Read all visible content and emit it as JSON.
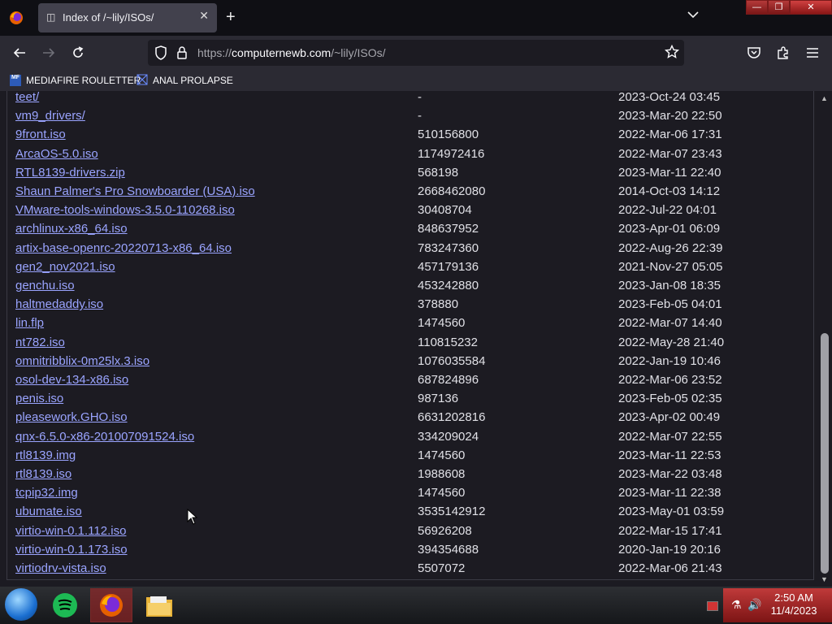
{
  "browser": {
    "tab_title": "Index of /~lily/ISOs/",
    "url_prefix": "https://",
    "url_domain": "computernewb.com",
    "url_path": "/~lily/ISOs/"
  },
  "bookmarks": [
    {
      "label": "MEDIAFIRE ROULETTER",
      "icon_text": "MF"
    },
    {
      "label": "ANAL PROLAPSE"
    }
  ],
  "files": [
    {
      "name": "teet/",
      "size": "-",
      "date": "2023-Oct-24 03:45"
    },
    {
      "name": "vm9_drivers/",
      "size": "-",
      "date": "2023-Mar-20 22:50"
    },
    {
      "name": "9front.iso",
      "size": "510156800",
      "date": "2022-Mar-06 17:31"
    },
    {
      "name": "ArcaOS-5.0.iso",
      "size": "1174972416",
      "date": "2022-Mar-07 23:43"
    },
    {
      "name": "RTL8139-drivers.zip",
      "size": "568198",
      "date": "2023-Mar-11 22:40"
    },
    {
      "name": "Shaun Palmer's Pro Snowboarder (USA).iso",
      "size": "2668462080",
      "date": "2014-Oct-03 14:12"
    },
    {
      "name": "VMware-tools-windows-3.5.0-110268.iso",
      "size": "30408704",
      "date": "2022-Jul-22 04:01"
    },
    {
      "name": "archlinux-x86_64.iso",
      "size": "848637952",
      "date": "2023-Apr-01 06:09"
    },
    {
      "name": "artix-base-openrc-20220713-x86_64.iso",
      "size": "783247360",
      "date": "2022-Aug-26 22:39"
    },
    {
      "name": "gen2_nov2021.iso",
      "size": "457179136",
      "date": "2021-Nov-27 05:05"
    },
    {
      "name": "genchu.iso",
      "size": "453242880",
      "date": "2023-Jan-08 18:35"
    },
    {
      "name": "haltmedaddy.iso",
      "size": "378880",
      "date": "2023-Feb-05 04:01"
    },
    {
      "name": "lin.flp",
      "size": "1474560",
      "date": "2022-Mar-07 14:40"
    },
    {
      "name": "nt782.iso",
      "size": "110815232",
      "date": "2022-May-28 21:40"
    },
    {
      "name": "omnitribblix-0m25lx.3.iso",
      "size": "1076035584",
      "date": "2022-Jan-19 10:46"
    },
    {
      "name": "osol-dev-134-x86.iso",
      "size": "687824896",
      "date": "2022-Mar-06 23:52"
    },
    {
      "name": "penis.iso",
      "size": "987136",
      "date": "2023-Feb-05 02:35"
    },
    {
      "name": "pleasework.GHO.iso",
      "size": "6631202816",
      "date": "2023-Apr-02 00:49"
    },
    {
      "name": "qnx-6.5.0-x86-201007091524.iso",
      "size": "334209024",
      "date": "2022-Mar-07 22:55"
    },
    {
      "name": "rtl8139.img",
      "size": "1474560",
      "date": "2023-Mar-11 22:53"
    },
    {
      "name": "rtl8139.iso",
      "size": "1988608",
      "date": "2023-Mar-22 03:48"
    },
    {
      "name": "tcpip32.img",
      "size": "1474560",
      "date": "2023-Mar-11 22:38"
    },
    {
      "name": "ubumate.iso",
      "size": "3535142912",
      "date": "2023-May-01 03:59"
    },
    {
      "name": "virtio-win-0.1.112.iso",
      "size": "56926208",
      "date": "2022-Mar-15 17:41"
    },
    {
      "name": "virtio-win-0.1.173.iso",
      "size": "394354688",
      "date": "2020-Jan-19 20:16"
    },
    {
      "name": "virtiodrv-vista.iso",
      "size": "5507072",
      "date": "2022-Mar-06 21:43"
    }
  ],
  "taskbar": {
    "time": "2:50 AM",
    "date": "11/4/2023"
  },
  "colors": {
    "link": "#9aa4ff",
    "page_bg": "#1c1b22",
    "tray_red": "#c03a3a"
  }
}
